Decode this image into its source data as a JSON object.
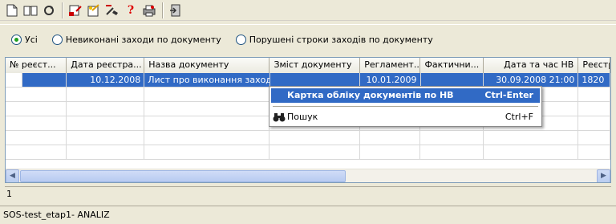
{
  "toolbar": {
    "buttons": [
      {
        "name": "new-document-icon"
      },
      {
        "name": "open-book-icon"
      },
      {
        "name": "refresh-icon"
      },
      {
        "name": "add-record-icon"
      },
      {
        "name": "edit-record-icon"
      },
      {
        "name": "filter-tool-icon"
      },
      {
        "name": "help-icon",
        "label": "?"
      },
      {
        "name": "print-icon"
      },
      {
        "name": "exit-icon"
      }
    ]
  },
  "filters": {
    "options": [
      {
        "label": "Усі",
        "selected": true
      },
      {
        "label": "Невиконані заходи по документу",
        "selected": false
      },
      {
        "label": "Порушені строки заходів по документу",
        "selected": false
      }
    ]
  },
  "grid": {
    "columns": [
      "№ реєст...",
      "Дата реєстра...",
      "Назва документу",
      "Зміст документу",
      "Регламент...",
      "Фактични...",
      "Дата та час НВ",
      "Реєстр"
    ],
    "rows": [
      [
        "",
        "10.12.2008",
        "Лист про виконання заходів",
        "",
        "10.01.2009",
        "",
        "30.09.2008 21:00",
        "1820"
      ]
    ]
  },
  "context_menu": {
    "items": [
      {
        "label": "Картка обліку документів по НВ",
        "shortcut": "Ctrl-Enter"
      },
      {
        "label": "Пошук",
        "shortcut": "Ctrl+F"
      }
    ]
  },
  "count_text": "1",
  "status_text": "SOS-test_etap1- ANALIZ",
  "colors": {
    "selection": "#316ac5",
    "background": "#ece9d8"
  }
}
